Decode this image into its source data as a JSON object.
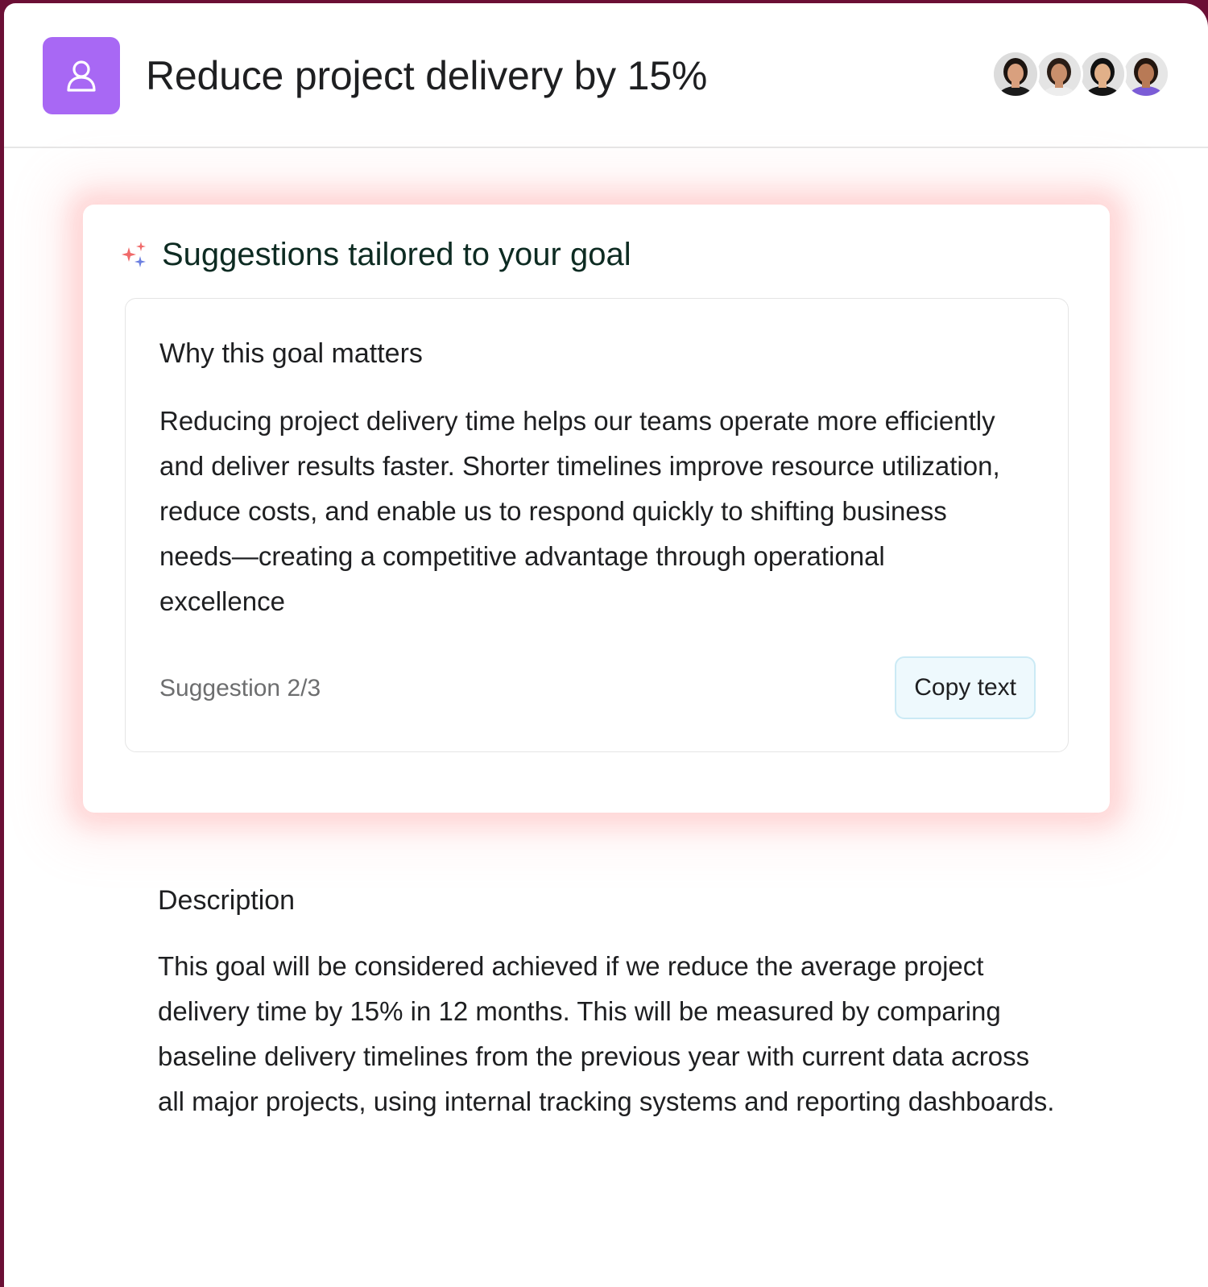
{
  "header": {
    "title": "Reduce project delivery by 15%",
    "icon": "goal-user-icon",
    "icon_color": "#a868f4",
    "avatars": [
      {
        "name": "avatar-1",
        "skin": "#d9a07e",
        "hair": "#1c1410",
        "shirt": "#1b1b1b",
        "bg": "#dcdcdc"
      },
      {
        "name": "avatar-2",
        "skin": "#c98f6c",
        "hair": "#2a1d16",
        "shirt": "#ededed",
        "bg": "#e4e4e4"
      },
      {
        "name": "avatar-3",
        "skin": "#e1b089",
        "hair": "#111111",
        "shirt": "#151515",
        "bg": "#e0e0e0"
      },
      {
        "name": "avatar-4",
        "skin": "#b87a56",
        "hair": "#23160f",
        "shirt": "#7b5cd6",
        "bg": "#e6e6e6"
      }
    ]
  },
  "suggestions": {
    "heading": "Suggestions tailored to your goal",
    "icon": "sparkle-icon",
    "card": {
      "title": "Why this goal matters",
      "body": "Reducing project delivery time helps our teams operate more efficiently and deliver results faster. Shorter timelines improve resource utilization, reduce costs, and enable us to respond quickly to shifting business needs—creating a competitive advantage through operational excellence",
      "counter": "Suggestion 2/3",
      "copy_label": "Copy text"
    }
  },
  "description": {
    "title": "Description",
    "body": "This goal will be considered achieved if we reduce the average project delivery time by 15% in 12 months. This will be measured by comparing baseline delivery timelines from the previous year with current data across all major projects, using internal tracking systems and reporting dashboards."
  }
}
